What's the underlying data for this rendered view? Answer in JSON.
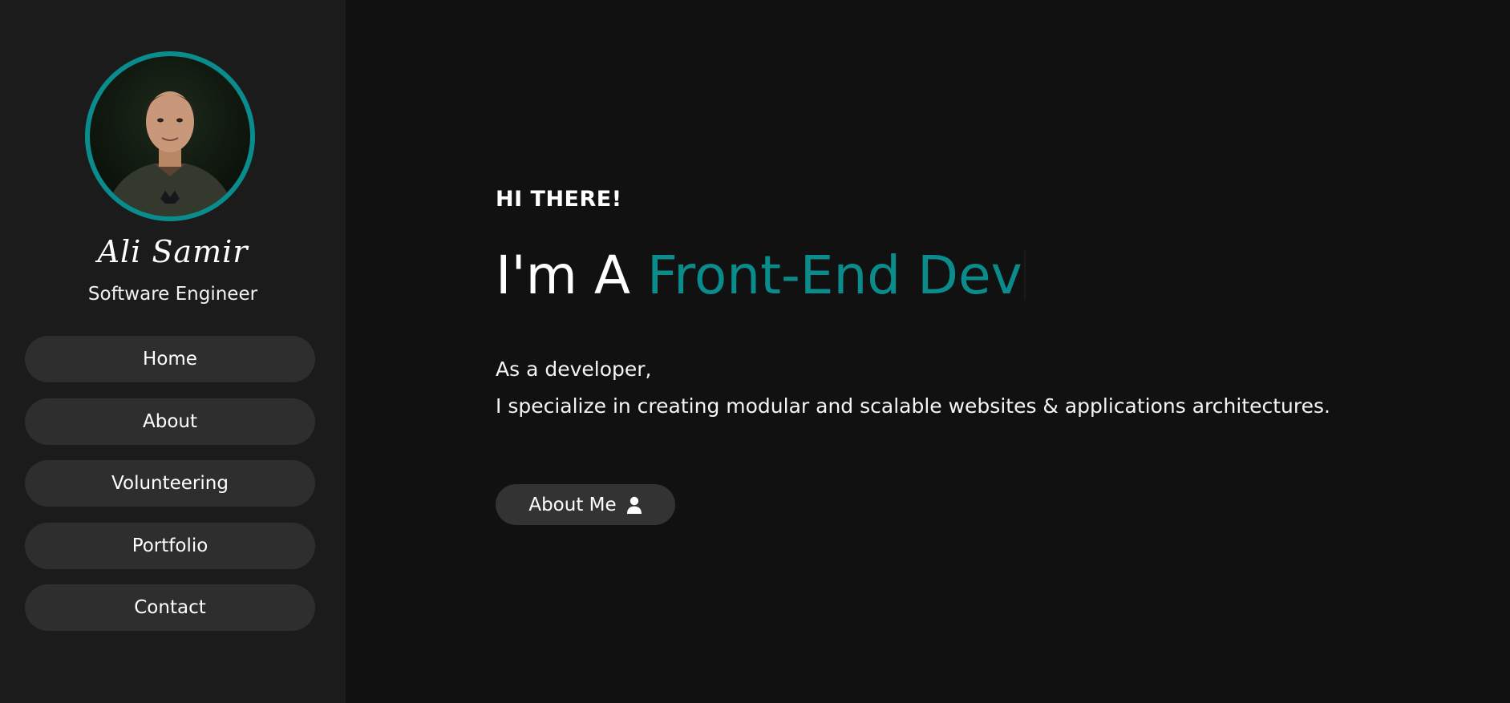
{
  "sidebar": {
    "profile": {
      "name": "Ali Samir",
      "role": "Software Engineer"
    },
    "nav": [
      {
        "label": "Home"
      },
      {
        "label": "About"
      },
      {
        "label": "Volunteering"
      },
      {
        "label": "Portfolio"
      },
      {
        "label": "Contact"
      }
    ]
  },
  "hero": {
    "greeting": "HI THERE!",
    "headline_prefix": "I'm A",
    "headline_highlight": "Front-End Dev",
    "description_lines": [
      "As a developer,",
      "I specialize in creating modular and scalable websites & applications architectures."
    ],
    "cta_label": "About Me",
    "cta_icon": "user-icon"
  },
  "colors": {
    "accent": "#0b8c8c",
    "background": "#111111",
    "sidebar": "#1b1b1b",
    "button": "#2e2e2e"
  }
}
